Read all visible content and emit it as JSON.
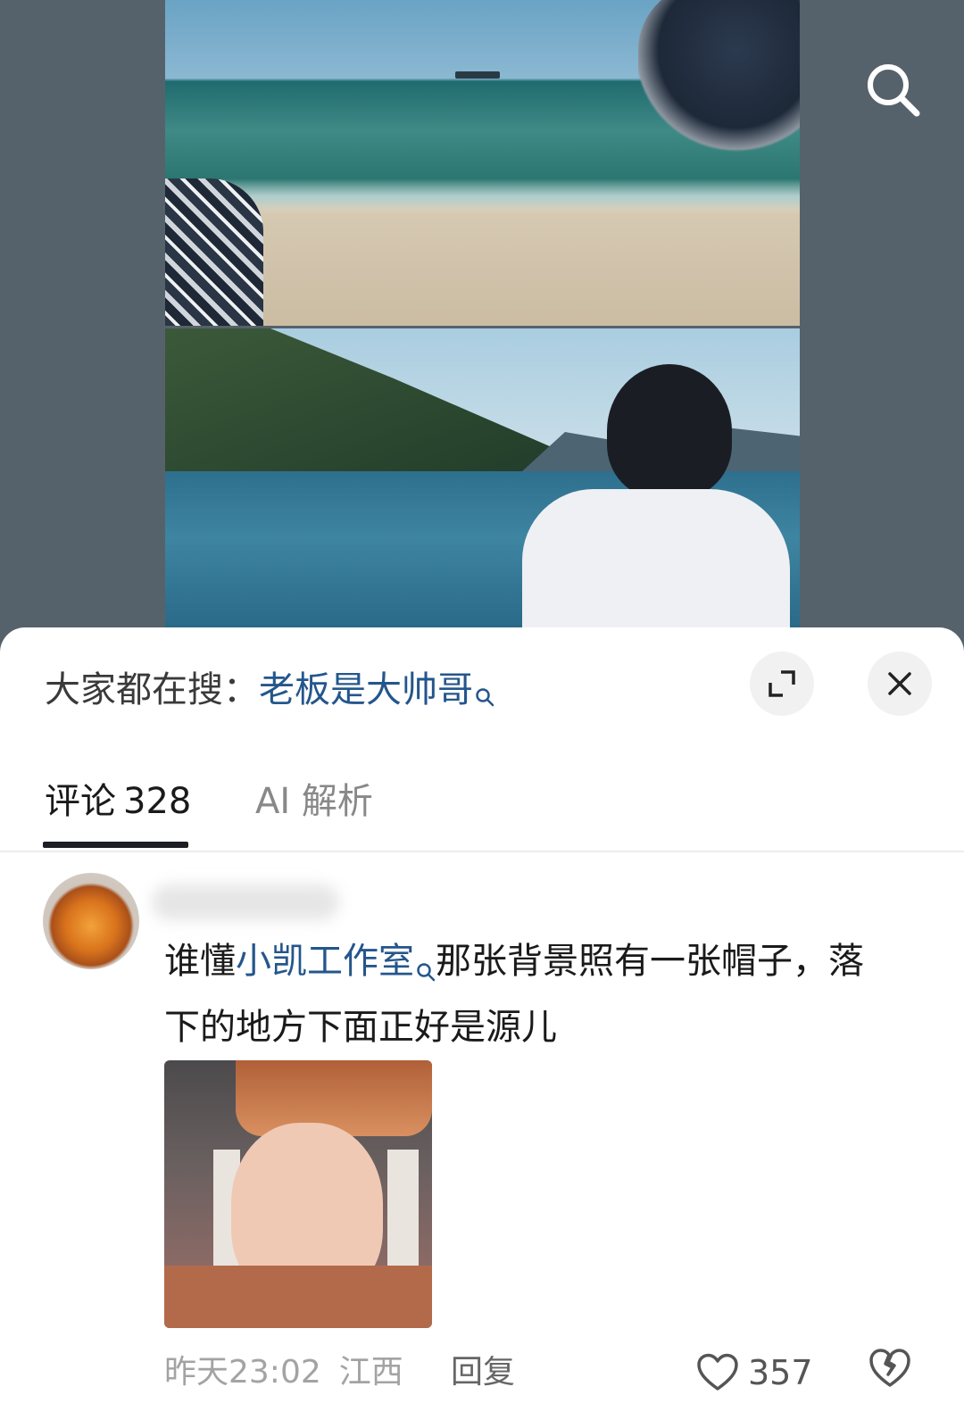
{
  "hot_search": {
    "prefix": "大家都在搜：",
    "keyword": "老板是大帅哥"
  },
  "tabs": [
    {
      "label": "评论",
      "count": "328",
      "active": true
    },
    {
      "label": "AI 解析",
      "active": false
    }
  ],
  "comment": {
    "text_before": "谁懂",
    "mention": "小凯工作室",
    "text_after": "那张背景照有一张帽子，落下的地方下面正好是源儿",
    "time": "昨天23:02",
    "location": "江西",
    "reply_label": "回复",
    "like_count": "357"
  },
  "icons": {
    "search": "search-icon",
    "expand": "expand-icon",
    "close": "close-icon",
    "like": "heart-icon",
    "dislike": "broken-heart-icon"
  },
  "colors": {
    "link": "#24568c",
    "background": "#56626b"
  }
}
